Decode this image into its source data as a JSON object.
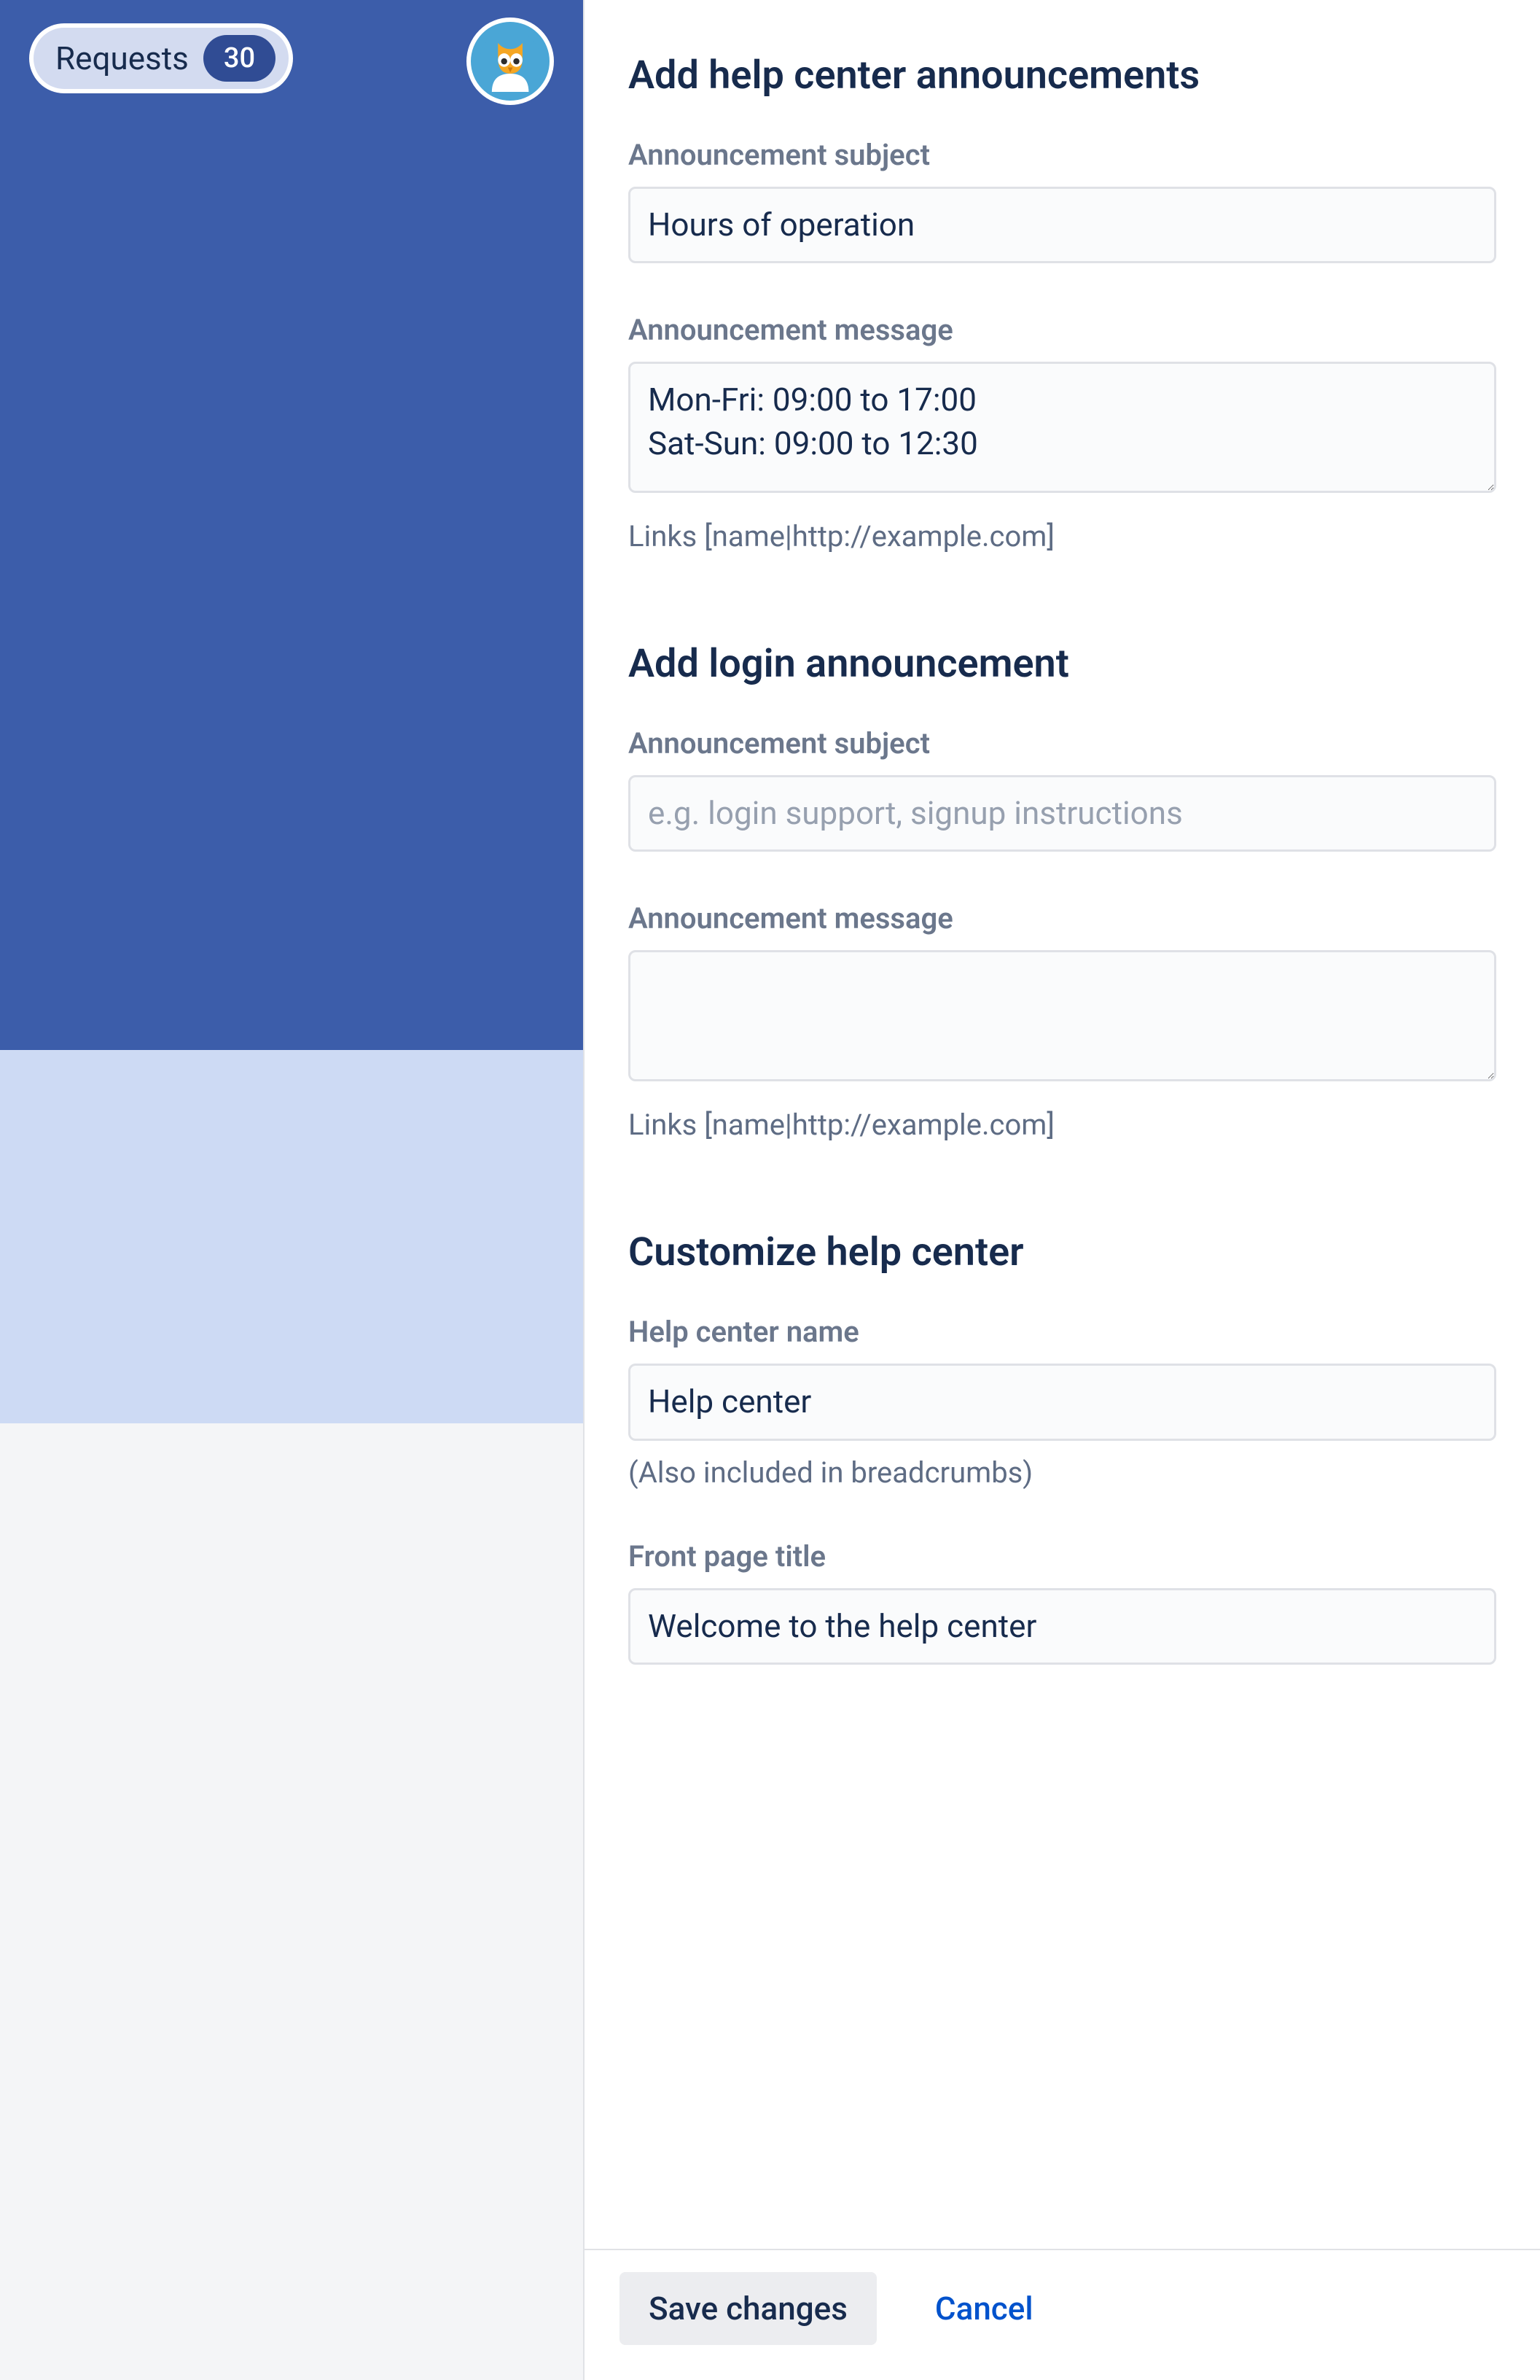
{
  "sidebar": {
    "requests_label": "Requests",
    "requests_count": "30"
  },
  "sections": {
    "helpcenter_announcements": {
      "heading": "Add help center announcements",
      "subject_label": "Announcement subject",
      "subject_value": "Hours of operation",
      "message_label": "Announcement message",
      "message_value": "Mon-Fri: 09:00 to 17:00\nSat-Sun: 09:00 to 12:30",
      "links_hint": "Links [name|http://example.com]"
    },
    "login_announcement": {
      "heading": "Add login announcement",
      "subject_label": "Announcement subject",
      "subject_placeholder": "e.g. login support, signup instructions",
      "subject_value": "",
      "message_label": "Announcement message",
      "message_value": "",
      "links_hint": "Links [name|http://example.com]"
    },
    "customize": {
      "heading": "Customize help center",
      "name_label": "Help center name",
      "name_value": "Help center",
      "name_hint": "(Also included in breadcrumbs)",
      "front_title_label": "Front page title",
      "front_title_value": "Welcome to the help center"
    }
  },
  "footer": {
    "save_label": "Save changes",
    "cancel_label": "Cancel"
  }
}
